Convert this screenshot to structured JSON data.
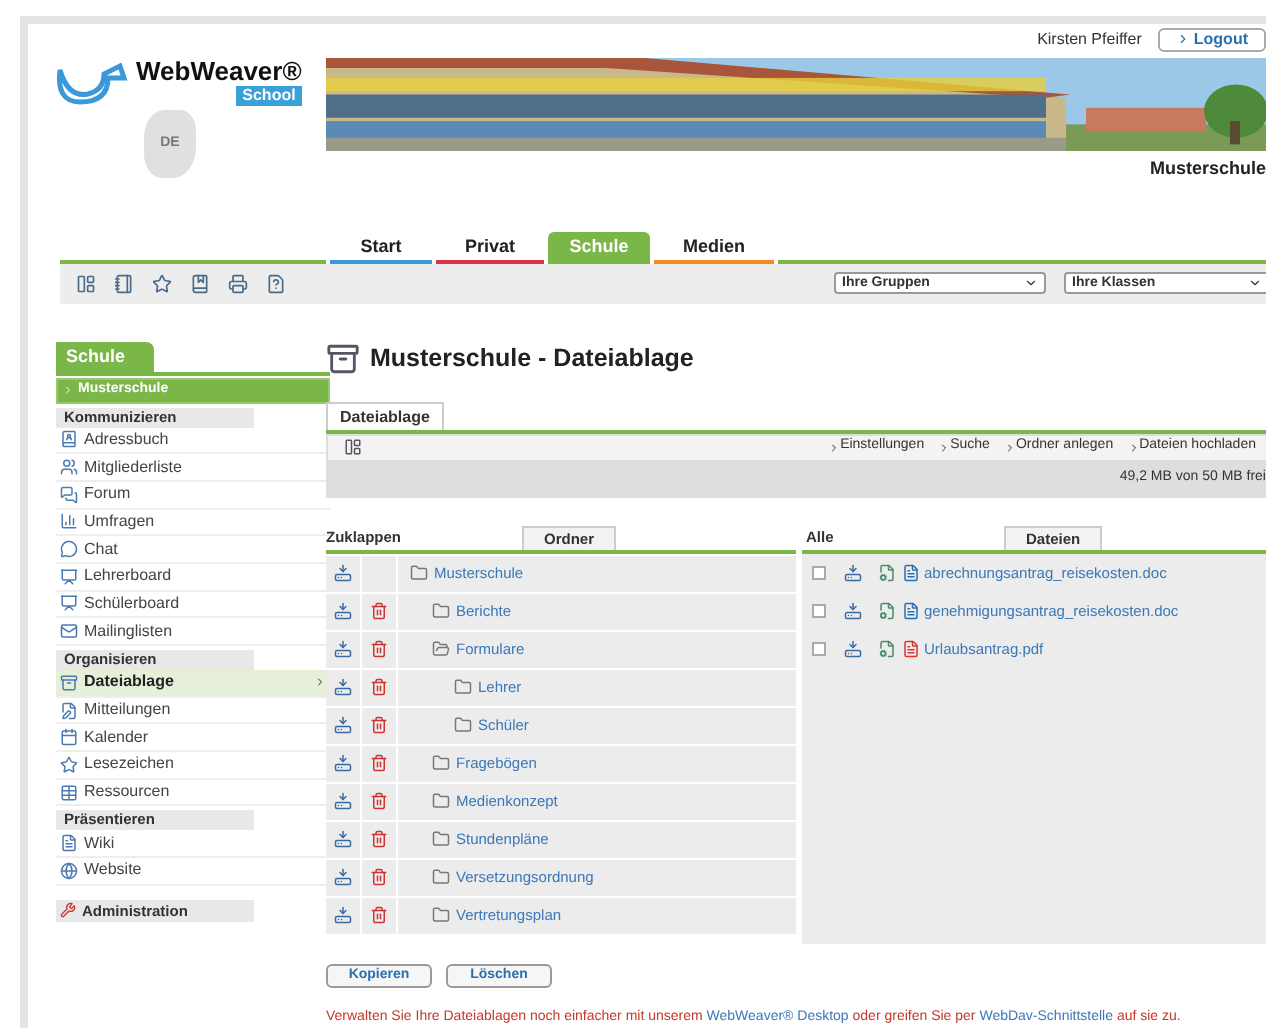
{
  "user": {
    "name": "Kirsten Pfeiffer",
    "logout": "Logout"
  },
  "logo": {
    "name": "WebWeaver®",
    "badge": "School",
    "country": "DE"
  },
  "banner": {
    "kind": "picture",
    "school": "Musterschule"
  },
  "nav_tabs": [
    {
      "label": "Start",
      "selected": false,
      "color": "#3a9ad9"
    },
    {
      "label": "Privat",
      "selected": false,
      "color": "#d9344a"
    },
    {
      "label": "Schule",
      "selected": true,
      "color": "#7ab648"
    },
    {
      "label": "Medien",
      "selected": false,
      "color": "#f08a24"
    }
  ],
  "selects": [
    {
      "value": "Ihre Gruppen"
    },
    {
      "value": "Ihre Klassen"
    }
  ],
  "sidebar": {
    "tab": "Schule",
    "current": "Musterschule",
    "sections": [
      {
        "title": "Kommunizieren",
        "items": [
          {
            "label": "Adressbuch",
            "selected": false
          },
          {
            "label": "Mitgliederliste",
            "selected": false
          },
          {
            "label": "Forum",
            "selected": false
          },
          {
            "label": "Umfragen",
            "selected": false
          },
          {
            "label": "Chat",
            "selected": false
          },
          {
            "label": "Lehrerboard",
            "selected": false
          },
          {
            "label": "Schülerboard",
            "selected": false
          },
          {
            "label": "Mailinglisten",
            "selected": false
          }
        ]
      },
      {
        "title": "Organisieren",
        "items": [
          {
            "label": "Dateiablage",
            "selected": true
          },
          {
            "label": "Mitteilungen",
            "selected": false
          },
          {
            "label": "Kalender",
            "selected": false
          },
          {
            "label": "Lesezeichen",
            "selected": false
          },
          {
            "label": "Ressourcen",
            "selected": false
          }
        ]
      },
      {
        "title": "Präsentieren",
        "items": [
          {
            "label": "Wiki",
            "selected": false
          },
          {
            "label": "Website",
            "selected": false
          }
        ]
      }
    ],
    "admin": "Administration"
  },
  "page_title": "Musterschule - Dateiablage",
  "tab": "Dateiablage",
  "actions": [
    "Einstellungen",
    "Suche",
    "Ordner anlegen",
    "Dateien hochladen"
  ],
  "quota": "49,2 MB von 50 MB frei",
  "folders": {
    "collapse": "Zuklappen",
    "header": "Ordner",
    "tree": [
      {
        "label": "Musterschule",
        "open": false,
        "deletable": false,
        "children": [
          {
            "label": "Berichte",
            "open": false,
            "deletable": true
          },
          {
            "label": "Formulare",
            "open": true,
            "deletable": true,
            "children": [
              {
                "label": "Lehrer",
                "open": false,
                "deletable": true
              },
              {
                "label": "Schüler",
                "open": false,
                "deletable": true
              }
            ]
          },
          {
            "label": "Fragebögen",
            "open": false,
            "deletable": true
          },
          {
            "label": "Medienkonzept",
            "open": false,
            "deletable": true
          },
          {
            "label": "Stundenpläne",
            "open": false,
            "deletable": true
          },
          {
            "label": "Versetzungsordnung",
            "open": false,
            "deletable": true
          },
          {
            "label": "Vertretungsplan",
            "open": false,
            "deletable": true
          }
        ]
      }
    ]
  },
  "files": {
    "select_all": "Alle",
    "header": "Dateien",
    "items": [
      {
        "name": "abrechnungsantrag_reisekosten.doc",
        "kind": "doc",
        "checked": false
      },
      {
        "name": "genehmigungsantrag_reisekosten.doc",
        "kind": "doc",
        "checked": false
      },
      {
        "name": "Urlaubsantrag.pdf",
        "kind": "pdf",
        "checked": false
      }
    ]
  },
  "buttons": [
    "Kopieren",
    "Löschen"
  ],
  "footer": [
    {
      "kind": "text",
      "text": "Verwalten Sie Ihre Dateiablagen noch einfacher mit unserem"
    },
    {
      "kind": "link",
      "text": "WebWeaver® Desktop"
    },
    {
      "kind": "text",
      "text": "oder greifen Sie per"
    },
    {
      "kind": "link",
      "text": "WebDav-Schnittstelle"
    },
    {
      "kind": "text",
      "text": "auf sie zu."
    }
  ]
}
